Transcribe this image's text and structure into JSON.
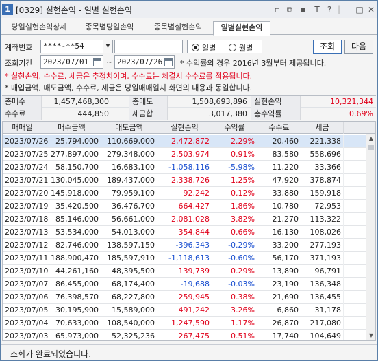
{
  "window": {
    "number": "1",
    "title": "[0329] 실현손익 - 일별 실현손익",
    "controls": [
      "▫",
      "⧉",
      "▪",
      "T",
      "?",
      "|",
      "_",
      "□",
      "✕"
    ]
  },
  "tabs": [
    {
      "label": "당일실현손익상세"
    },
    {
      "label": "종목별당일손익"
    },
    {
      "label": "종목별실현손익"
    },
    {
      "label": "일별실현손익"
    }
  ],
  "form": {
    "account_label": "계좌번호",
    "account_value": "****-**54",
    "account_name": "",
    "period_label": "조회기간",
    "date_from": "2023/07/01",
    "date_to": "2023/07/26",
    "tilde": "~",
    "period_note": "* 수익률의 경우 2016년 3월부터 제공됩니다.",
    "radio_daily": "일별",
    "radio_monthly": "월별",
    "selected_mode": "일별",
    "query_button": "조회",
    "next_button": "다음"
  },
  "notes": {
    "line1": "* 실현손익, 수수료, 세금은 추정치이며, 수수료는 체결시 수수료를 적용됩니다.",
    "line2": "* 매입금액, 매도금액, 수수료, 세금은 당일매매일지 화면의 내용과 동일합니다."
  },
  "summary": {
    "row1": [
      {
        "label": "총매수",
        "value": "1,457,468,300"
      },
      {
        "label": "총매도",
        "value": "1,508,693,896"
      },
      {
        "label": "실현손익",
        "value": "10,321,344"
      }
    ],
    "row2": [
      {
        "label": "수수료",
        "value": "444,850"
      },
      {
        "label": "세금합",
        "value": "3,017,380"
      },
      {
        "label": "총수익률",
        "value": "0.69%"
      }
    ],
    "accent_color": "#e0001a"
  },
  "table": {
    "headers": [
      "매매일",
      "매수금액",
      "매도금액",
      "실현손익",
      "수익률",
      "수수료",
      "세금"
    ],
    "rows": [
      [
        "2023/07/26",
        "25,794,000",
        "110,669,000",
        "2,472,872",
        "2.29%",
        "20,460",
        "221,338"
      ],
      [
        "2023/07/25",
        "277,897,000",
        "279,348,000",
        "2,503,974",
        "0.91%",
        "83,580",
        "558,696"
      ],
      [
        "2023/07/24",
        "58,150,700",
        "16,683,100",
        "-1,058,116",
        "-5.98%",
        "11,220",
        "33,366"
      ],
      [
        "2023/07/21",
        "130,045,000",
        "189,437,000",
        "2,338,726",
        "1.25%",
        "47,920",
        "378,874"
      ],
      [
        "2023/07/20",
        "145,918,000",
        "79,959,100",
        "92,242",
        "0.12%",
        "33,880",
        "159,918"
      ],
      [
        "2023/07/19",
        "35,420,500",
        "36,476,700",
        "664,427",
        "1.86%",
        "10,780",
        "72,953"
      ],
      [
        "2023/07/18",
        "85,146,000",
        "56,661,000",
        "2,081,028",
        "3.82%",
        "21,270",
        "113,322"
      ],
      [
        "2023/07/13",
        "53,534,000",
        "54,013,000",
        "354,844",
        "0.66%",
        "16,130",
        "108,026"
      ],
      [
        "2023/07/12",
        "82,746,000",
        "138,597,150",
        "-396,343",
        "-0.29%",
        "33,200",
        "277,193"
      ],
      [
        "2023/07/11",
        "188,900,470",
        "185,597,910",
        "-1,118,613",
        "-0.60%",
        "56,170",
        "371,193"
      ],
      [
        "2023/07/10",
        "44,261,160",
        "48,395,500",
        "139,739",
        "0.29%",
        "13,890",
        "96,791"
      ],
      [
        "2023/07/07",
        "86,455,000",
        "68,174,400",
        "-19,688",
        "-0.03%",
        "23,190",
        "136,348"
      ],
      [
        "2023/07/06",
        "76,398,570",
        "68,227,800",
        "259,945",
        "0.38%",
        "21,690",
        "136,455"
      ],
      [
        "2023/07/05",
        "30,195,900",
        "15,589,000",
        "491,242",
        "3.26%",
        "6,860",
        "31,178"
      ],
      [
        "2023/07/04",
        "70,633,000",
        "108,540,000",
        "1,247,590",
        "1.17%",
        "26,870",
        "217,080"
      ],
      [
        "2023/07/03",
        "65,973,000",
        "52,325,236",
        "267,475",
        "0.51%",
        "17,740",
        "104,649"
      ]
    ],
    "positive_color": "#e0001a",
    "negative_color": "#1a4fd0"
  },
  "status": {
    "message": "조회가 완료되었습니다."
  }
}
